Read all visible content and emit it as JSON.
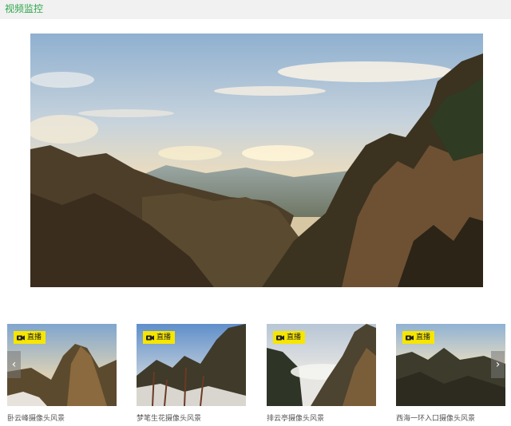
{
  "header": {
    "title": "视频监控"
  },
  "main_video": {
    "scene": "mountain-landscape"
  },
  "carousel": {
    "prev_icon": "chevron-left-icon",
    "next_icon": "chevron-right-icon",
    "prev_glyph": "‹",
    "next_glyph": "›",
    "items": [
      {
        "badge": "直播",
        "caption": "卧云峰摄像头风景"
      },
      {
        "badge": "直播",
        "caption": "梦笔生花摄像头风景"
      },
      {
        "badge": "直播",
        "caption": "排云亭摄像头风景"
      },
      {
        "badge": "直播",
        "caption": "西海一环入口摄像头风景"
      }
    ]
  },
  "colors": {
    "title": "#2da54a",
    "badge": "#f6e600"
  }
}
